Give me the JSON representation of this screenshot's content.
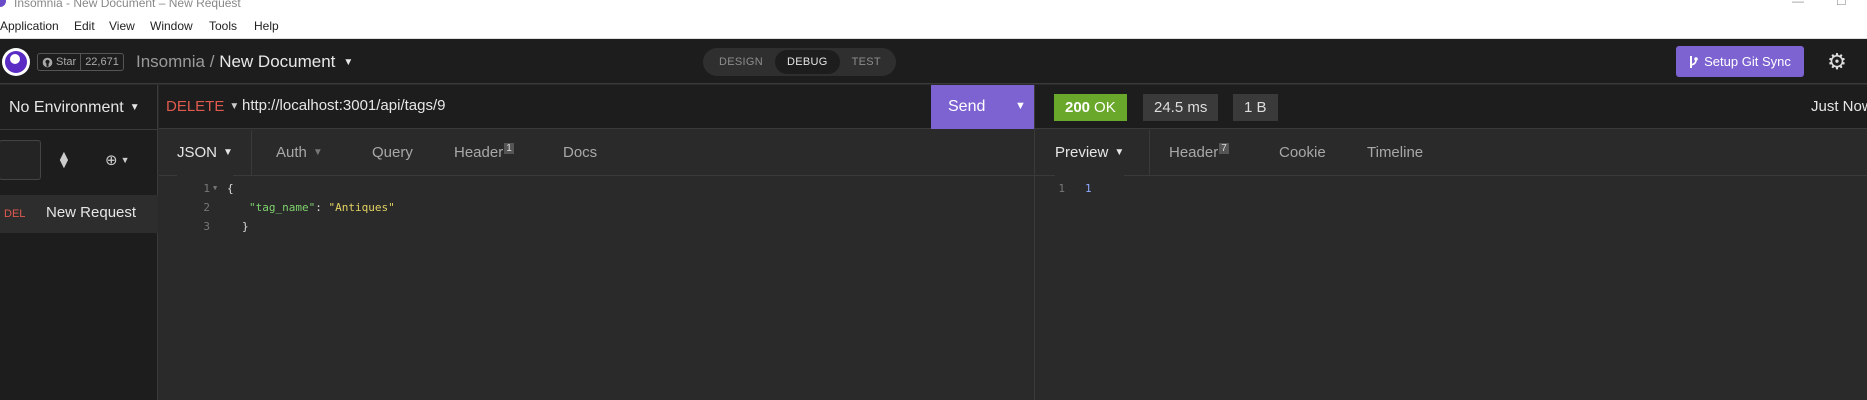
{
  "window": {
    "title": "Insomnia - New Document – New Request"
  },
  "menu": [
    "Application",
    "Edit",
    "View",
    "Window",
    "Tools",
    "Help"
  ],
  "header": {
    "github": {
      "star_label": "Star",
      "star_count": "22,671"
    },
    "breadcrumb": {
      "app": "Insomnia",
      "separator": "/",
      "document": "New Document"
    },
    "modes": [
      "DESIGN",
      "DEBUG",
      "TEST"
    ],
    "active_mode": "DEBUG",
    "git_sync_label": "Setup Git Sync"
  },
  "sidebar": {
    "environment_label": "No Environment",
    "requests": [
      {
        "method": "DEL",
        "name": "New Request"
      }
    ]
  },
  "request": {
    "method": "DELETE",
    "url": "http://localhost:3001/api/tags/9",
    "send_label": "Send",
    "tabs": [
      {
        "label": "JSON"
      },
      {
        "label": "Auth"
      },
      {
        "label": "Query"
      },
      {
        "label": "Header",
        "badge": "1"
      },
      {
        "label": "Docs"
      }
    ],
    "body_lines": [
      {
        "num": "1",
        "text": "{"
      },
      {
        "num": "2",
        "key": "\"tag_name\"",
        "sep": ": ",
        "value": "\"Antiques\""
      },
      {
        "num": "3",
        "text": "}"
      }
    ]
  },
  "response": {
    "status_code": "200",
    "status_text": "OK",
    "time": "24.5 ms",
    "size": "1 B",
    "timestamp": "Just Now",
    "tabs": [
      {
        "label": "Preview"
      },
      {
        "label": "Header",
        "badge": "7"
      },
      {
        "label": "Cookie"
      },
      {
        "label": "Timeline"
      }
    ],
    "body_lines": [
      {
        "num": "1",
        "text": "1"
      }
    ]
  },
  "colors": {
    "accent": "#7d63d2",
    "status_ok": "#6aa82b",
    "method_delete": "#e05a4e",
    "json_key": "#7ed36d",
    "json_string": "#e3d262"
  }
}
